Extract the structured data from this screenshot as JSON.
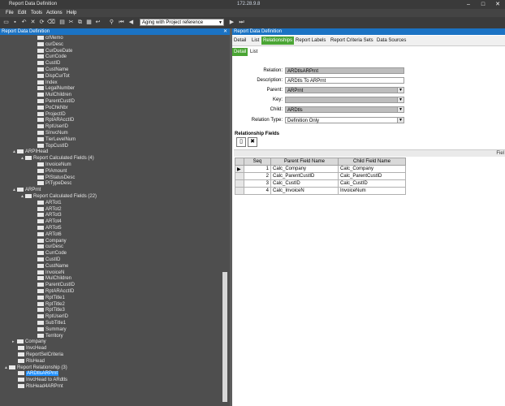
{
  "window": {
    "title": "Report Data Definition",
    "ip": "172.28.9.8"
  },
  "menu": [
    "File",
    "Edit",
    "Tools",
    "Actions",
    "Help"
  ],
  "toolbar": {
    "report_combo": "Aging with Project reference"
  },
  "left_panel": {
    "header": "Report Data Definition",
    "tree": [
      {
        "label": "crMemo",
        "indent": 3
      },
      {
        "label": "curDesc",
        "indent": 3
      },
      {
        "label": "CurDueDate",
        "indent": 3
      },
      {
        "label": "CurrCode",
        "indent": 3
      },
      {
        "label": "CustID",
        "indent": 3
      },
      {
        "label": "CustName",
        "indent": 3
      },
      {
        "label": "DispCurTot",
        "indent": 3
      },
      {
        "label": "Index",
        "indent": 3
      },
      {
        "label": "LegalNumber",
        "indent": 3
      },
      {
        "label": "MulChildren",
        "indent": 3
      },
      {
        "label": "ParentCustID",
        "indent": 3
      },
      {
        "label": "PoChkNbr",
        "indent": 3
      },
      {
        "label": "ProjectID",
        "indent": 3
      },
      {
        "label": "RptARAcctID",
        "indent": 3
      },
      {
        "label": "RptUserID",
        "indent": 3
      },
      {
        "label": "SInvcNum",
        "indent": 3
      },
      {
        "label": "TierLevelNum",
        "indent": 3
      },
      {
        "label": "TopCustID",
        "indent": 3
      },
      {
        "label": "ARPIHead",
        "indent": 1,
        "expander": "▲"
      },
      {
        "label": "Report Calculated Fields (4)",
        "indent": 2,
        "expander": "▲"
      },
      {
        "label": "InvoiceNum",
        "indent": 3
      },
      {
        "label": "PIAmount",
        "indent": 3
      },
      {
        "label": "PIStatusDesc",
        "indent": 3
      },
      {
        "label": "PITypeDesc",
        "indent": 3
      },
      {
        "label": "ARPrnt",
        "indent": 1,
        "expander": "▲"
      },
      {
        "label": "Report Calculated Fields (22)",
        "indent": 2,
        "expander": "▲"
      },
      {
        "label": "ARTot1",
        "indent": 3
      },
      {
        "label": "ARTot2",
        "indent": 3
      },
      {
        "label": "ARTot3",
        "indent": 3
      },
      {
        "label": "ARTot4",
        "indent": 3
      },
      {
        "label": "ARTot5",
        "indent": 3
      },
      {
        "label": "ARTot6",
        "indent": 3
      },
      {
        "label": "Company",
        "indent": 3
      },
      {
        "label": "curDesc",
        "indent": 3
      },
      {
        "label": "CurrCode",
        "indent": 3
      },
      {
        "label": "CustID",
        "indent": 3
      },
      {
        "label": "CustName",
        "indent": 3
      },
      {
        "label": "InvoiceN",
        "indent": 3
      },
      {
        "label": "MulChildren",
        "indent": 3
      },
      {
        "label": "ParentCustID",
        "indent": 3
      },
      {
        "label": "RptARAcctID",
        "indent": 3
      },
      {
        "label": "RptTitle1",
        "indent": 3
      },
      {
        "label": "RptTitle2",
        "indent": 3
      },
      {
        "label": "RptTitle3",
        "indent": 3
      },
      {
        "label": "RptUserID",
        "indent": 3
      },
      {
        "label": "SubTitle1",
        "indent": 3
      },
      {
        "label": "Summary",
        "indent": 3
      },
      {
        "label": "Territory",
        "indent": 3
      },
      {
        "label": "Company",
        "indent": 1,
        "expander": "▸"
      },
      {
        "label": "InvcHead",
        "indent": 1
      },
      {
        "label": "ReportSelCriteria",
        "indent": 1
      },
      {
        "label": "RlsHead",
        "indent": 1
      },
      {
        "label": "Report Relationship (3)",
        "indent": 0,
        "expander": "▲"
      },
      {
        "label": "ARDtlsARPrnt",
        "indent": 1,
        "selected": true
      },
      {
        "label": "InvcHead to ARdtls",
        "indent": 1
      },
      {
        "label": "RlsHead4ARPrnt",
        "indent": 1
      }
    ]
  },
  "right_panel": {
    "header": "Report Data Definition",
    "tabs": [
      "Detail",
      "List",
      "Relationships",
      "Report Labels",
      "Report Criteria Sets",
      "Data Sources"
    ],
    "active_tab": "Relationships",
    "subtabs": [
      "Detail",
      "List"
    ],
    "active_subtab": "Detail",
    "form": {
      "relation_label": "Relation:",
      "relation_value": "ARDtlsARPrnt",
      "description_label": "Description:",
      "description_value": "ARDtls To ARPrnt",
      "parent_label": "Parent:",
      "parent_value": "ARPrnt",
      "key_label": "Key:",
      "key_value": "",
      "child_label": "Child:",
      "child_value": "ARDtls",
      "relation_type_label": "Relation Type:",
      "relation_type_value": "Definition Only"
    },
    "relationship_fields": {
      "title": "Relationship Fields",
      "bar_text": "Fiel",
      "columns": [
        "Seq",
        "Parent Field Name",
        "Child Field Name"
      ],
      "rows": [
        {
          "seq": "1",
          "parent": "Calc_Company",
          "child": "Calc_Company"
        },
        {
          "seq": "2",
          "parent": "Calc_ParentCustID",
          "child": "Calc_ParentCustID"
        },
        {
          "seq": "3",
          "parent": "Calc_CustID",
          "child": "Calc_CustID"
        },
        {
          "seq": "4",
          "parent": "Calc_InvoiceN",
          "child": "InvoiceNum"
        }
      ]
    }
  }
}
